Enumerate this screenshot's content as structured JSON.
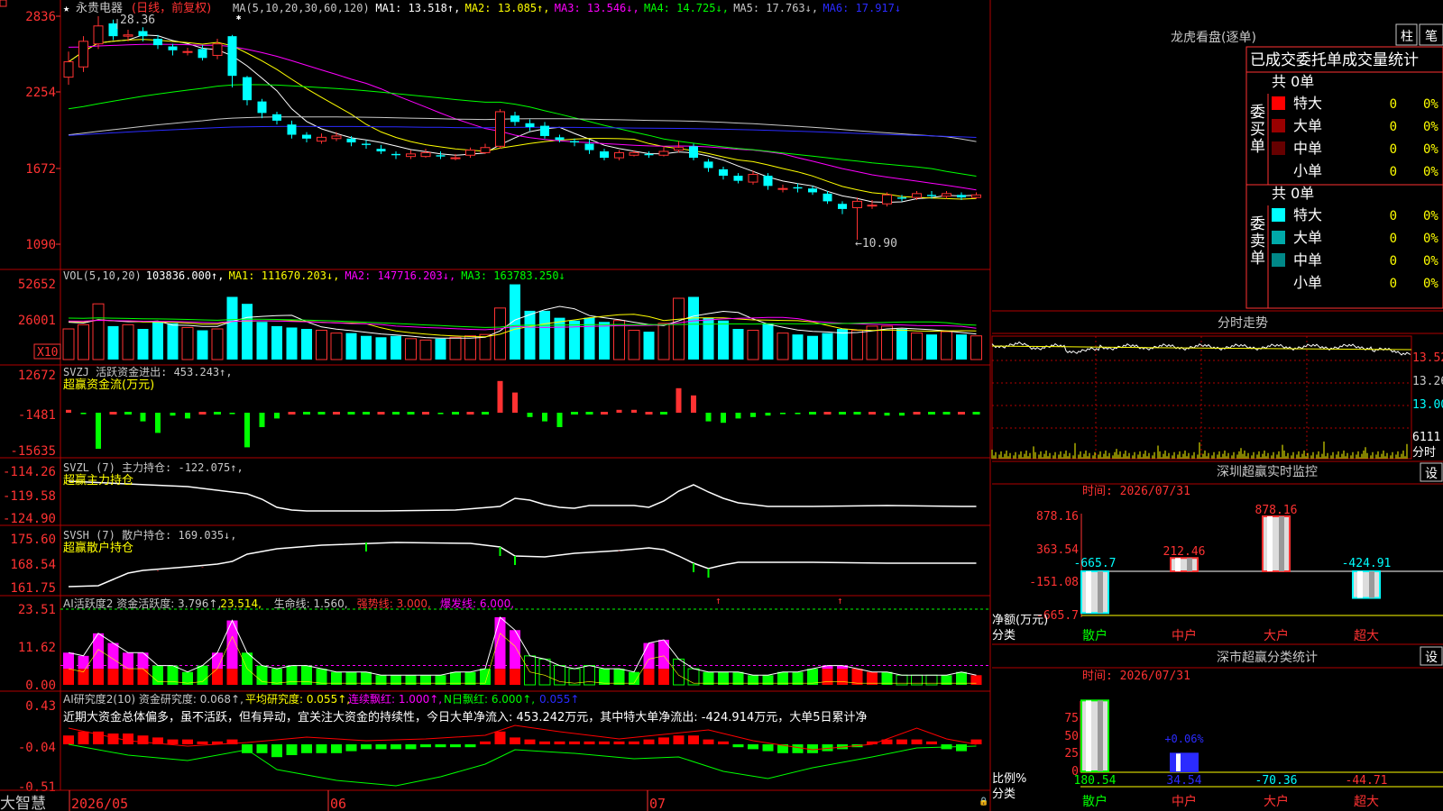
{
  "stock": {
    "name": "永贵电器",
    "mode": "(日线，前复权)",
    "hi_mark": "28.36",
    "lo_mark": "←10.90",
    "star": "★"
  },
  "main_yaxis": [
    "2836",
    "2254",
    "1672",
    "1090"
  ],
  "ma_header": [
    {
      "t": "MA(5,10,20,30,60,120)",
      "c": "#c8c8c8"
    },
    {
      "t": "MA1: 13.518↑,",
      "c": "#ffffff"
    },
    {
      "t": "MA2: 13.085↑,",
      "c": "#ffff00"
    },
    {
      "t": "MA3: 13.546↓,",
      "c": "#ff00ff"
    },
    {
      "t": "MA4: 14.725↓,",
      "c": "#00ff00"
    },
    {
      "t": "MA5: 17.763↓,",
      "c": "#c8c8c8"
    },
    {
      "t": "MA6: 17.917↓",
      "c": "#2b2bff"
    }
  ],
  "vol_header": [
    {
      "t": "VOL(5,10,20)",
      "c": "#c8c8c8"
    },
    {
      "t": "103836.000↑,",
      "c": "#ffffff"
    },
    {
      "t": "MA1: 111670.203↓,",
      "c": "#ffff00"
    },
    {
      "t": "MA2: 147716.203↓,",
      "c": "#ff00ff"
    },
    {
      "t": "MA3: 163783.250↓",
      "c": "#00ff00"
    }
  ],
  "vol_yaxis": [
    "52652",
    "26001"
  ],
  "vol_unit": "X10",
  "svzj": {
    "header": "SVZJ  活跃资金进出: 453.243↑,",
    "sub": "超赢资金流(万元)",
    "yaxis": [
      "12672",
      "-1481",
      "-15635"
    ]
  },
  "svzl": {
    "header": "SVZL (7) 主力持仓: -122.075↑,",
    "sub": "超赢主力持仓",
    "yaxis": [
      "-114.26",
      "-119.58",
      "-124.90"
    ]
  },
  "svsh": {
    "header": "SVSH (7) 散户持仓: 169.035↓,",
    "sub": "超赢散户持仓",
    "yaxis": [
      "175.60",
      "168.54",
      "161.75"
    ]
  },
  "ai1": {
    "header": [
      {
        "t": "AI活跃度2 资金活跃度: 3.796↑,",
        "c": "#c8c8c8"
      },
      {
        "t": "23.514,",
        "c": "#ffff00"
      },
      {
        "t": "生命线: 1.560,",
        "c": "#c8c8c8"
      },
      {
        "t": "强势线: 3.000,",
        "c": "#ff3333"
      },
      {
        "t": "爆发线: 6.000,",
        "c": "#ff00ff"
      }
    ],
    "yaxis": [
      "23.51",
      "11.62",
      "0.00"
    ]
  },
  "ai2": {
    "header": [
      {
        "t": "AI研究度2(10) 资金研究度: 0.068↑,",
        "c": "#c8c8c8"
      },
      {
        "t": "平均研究度: 0.055↑,",
        "c": "#ffff00"
      },
      {
        "t": "连续飘红: 1.000↑,",
        "c": "#ff00ff"
      },
      {
        "t": "N日飘红: 6.000↑,",
        "c": "#00ff00"
      },
      {
        "t": "0.055↑",
        "c": "#2b2bff"
      }
    ],
    "comment": "近期大资金总体偏多，虽不活跃，但有异动，宜关注大资金的持续性，今日大单净流入: 453.242万元，其中特大单净流出: -424.914万元，大单5日累计净",
    "yaxis": [
      "0.43",
      "-0.04",
      "-0.51"
    ]
  },
  "xaxis": {
    "brand": "大智慧",
    "labels": [
      "2026/05",
      "06",
      "07"
    ]
  },
  "candles": [
    {
      "o": 23.6,
      "c": 24.8,
      "h": 25.6,
      "l": 23.0
    },
    {
      "o": 24.4,
      "c": 26.4,
      "h": 26.8,
      "l": 24.0
    },
    {
      "o": 26.2,
      "c": 27.6,
      "h": 28.36,
      "l": 25.8
    },
    {
      "o": 27.8,
      "c": 26.8,
      "h": 28.1,
      "l": 26.5
    },
    {
      "o": 26.8,
      "c": 26.9,
      "h": 27.3,
      "l": 26.4
    },
    {
      "o": 27.2,
      "c": 26.8,
      "h": 27.5,
      "l": 26.4
    },
    {
      "o": 26.6,
      "c": 26.1,
      "h": 26.9,
      "l": 25.8
    },
    {
      "o": 26.0,
      "c": 25.7,
      "h": 26.2,
      "l": 25.3
    },
    {
      "o": 25.6,
      "c": 25.6,
      "h": 25.9,
      "l": 25.3
    },
    {
      "o": 25.8,
      "c": 25.1,
      "h": 26.1,
      "l": 24.9
    },
    {
      "o": 25.3,
      "c": 26.2,
      "h": 26.6,
      "l": 25.0
    },
    {
      "o": 26.8,
      "c": 23.7,
      "h": 26.9,
      "l": 22.8
    },
    {
      "o": 23.6,
      "c": 21.8,
      "h": 23.7,
      "l": 21.4
    },
    {
      "o": 21.7,
      "c": 20.8,
      "h": 21.9,
      "l": 20.4
    },
    {
      "o": 20.7,
      "c": 20.2,
      "h": 20.9,
      "l": 19.9
    },
    {
      "o": 19.9,
      "c": 19.1,
      "h": 20.2,
      "l": 18.8
    },
    {
      "o": 19.1,
      "c": 18.8,
      "h": 19.3,
      "l": 18.5
    },
    {
      "o": 18.6,
      "c": 18.9,
      "h": 19.2,
      "l": 18.4
    },
    {
      "o": 18.8,
      "c": 19.0,
      "h": 19.3,
      "l": 18.6
    },
    {
      "o": 18.8,
      "c": 18.5,
      "h": 19.0,
      "l": 18.2
    },
    {
      "o": 18.4,
      "c": 18.3,
      "h": 18.7,
      "l": 18.0
    },
    {
      "o": 18.0,
      "c": 17.8,
      "h": 18.3,
      "l": 17.6
    },
    {
      "o": 17.6,
      "c": 17.5,
      "h": 17.8,
      "l": 17.2
    },
    {
      "o": 17.4,
      "c": 17.6,
      "h": 17.9,
      "l": 17.2
    },
    {
      "o": 17.4,
      "c": 17.7,
      "h": 18.0,
      "l": 17.3
    },
    {
      "o": 17.5,
      "c": 17.4,
      "h": 17.8,
      "l": 17.2
    },
    {
      "o": 17.3,
      "c": 17.3,
      "h": 17.6,
      "l": 17.1
    },
    {
      "o": 17.5,
      "c": 17.9,
      "h": 18.1,
      "l": 17.3
    },
    {
      "o": 17.7,
      "c": 18.1,
      "h": 18.4,
      "l": 17.6
    },
    {
      "o": 18.2,
      "c": 20.9,
      "h": 21.1,
      "l": 18.0
    },
    {
      "o": 20.6,
      "c": 20.1,
      "h": 20.9,
      "l": 19.8
    },
    {
      "o": 20.0,
      "c": 19.7,
      "h": 20.3,
      "l": 19.4
    },
    {
      "o": 19.8,
      "c": 19.0,
      "h": 20.1,
      "l": 18.8
    },
    {
      "o": 18.9,
      "c": 18.7,
      "h": 19.1,
      "l": 18.5
    },
    {
      "o": 18.6,
      "c": 18.5,
      "h": 18.8,
      "l": 18.2
    },
    {
      "o": 18.4,
      "c": 17.9,
      "h": 18.7,
      "l": 17.6
    },
    {
      "o": 17.8,
      "c": 17.3,
      "h": 18.0,
      "l": 17.1
    },
    {
      "o": 17.3,
      "c": 17.7,
      "h": 17.9,
      "l": 17.1
    },
    {
      "o": 17.5,
      "c": 17.7,
      "h": 17.9,
      "l": 17.4
    },
    {
      "o": 17.6,
      "c": 17.5,
      "h": 17.8,
      "l": 17.3
    },
    {
      "o": 17.5,
      "c": 17.8,
      "h": 18.2,
      "l": 17.4
    },
    {
      "o": 17.9,
      "c": 18.1,
      "h": 18.6,
      "l": 17.7
    },
    {
      "o": 18.2,
      "c": 17.3,
      "h": 18.4,
      "l": 17.1
    },
    {
      "o": 17.0,
      "c": 16.5,
      "h": 17.2,
      "l": 16.2
    },
    {
      "o": 16.4,
      "c": 15.9,
      "h": 16.6,
      "l": 15.6
    },
    {
      "o": 15.9,
      "c": 15.5,
      "h": 16.1,
      "l": 15.3
    },
    {
      "o": 15.4,
      "c": 16.0,
      "h": 16.3,
      "l": 15.2
    },
    {
      "o": 15.9,
      "c": 15.1,
      "h": 16.1,
      "l": 14.8
    },
    {
      "o": 14.9,
      "c": 14.9,
      "h": 15.2,
      "l": 14.6
    },
    {
      "o": 15.0,
      "c": 14.9,
      "h": 15.3,
      "l": 14.6
    },
    {
      "o": 14.9,
      "c": 14.6,
      "h": 15.1,
      "l": 14.4
    },
    {
      "o": 14.5,
      "c": 13.9,
      "h": 14.7,
      "l": 13.7
    },
    {
      "o": 13.7,
      "c": 13.3,
      "h": 13.9,
      "l": 12.9
    },
    {
      "o": 13.4,
      "c": 13.9,
      "h": 14.2,
      "l": 10.9
    },
    {
      "o": 13.6,
      "c": 13.6,
      "h": 14.0,
      "l": 13.3
    },
    {
      "o": 13.7,
      "c": 14.4,
      "h": 14.6,
      "l": 13.5
    },
    {
      "o": 14.2,
      "c": 14.1,
      "h": 14.4,
      "l": 13.9
    },
    {
      "o": 14.2,
      "c": 14.5,
      "h": 14.7,
      "l": 14.0
    },
    {
      "o": 14.4,
      "c": 14.3,
      "h": 14.7,
      "l": 14.1
    },
    {
      "o": 14.3,
      "c": 14.5,
      "h": 14.7,
      "l": 14.1
    },
    {
      "o": 14.4,
      "c": 14.2,
      "h": 14.6,
      "l": 14.0
    },
    {
      "o": 14.2,
      "c": 14.4,
      "h": 14.6,
      "l": 14.1
    }
  ],
  "right": {
    "tabs": [
      "柱",
      "笔"
    ],
    "dragon": {
      "title": "龙虎看盘(逐单)",
      "header": "已成交委托单成交量统计",
      "buy": {
        "side": "委买单",
        "total": "共 0单",
        "rows": [
          {
            "label": "特大",
            "val": "0",
            "pct": "0%",
            "color": "#ff0000"
          },
          {
            "label": "大单",
            "val": "0",
            "pct": "0%",
            "color": "#990000"
          },
          {
            "label": "中单",
            "val": "0",
            "pct": "0%",
            "color": "#660000"
          },
          {
            "label": "小单",
            "val": "0",
            "pct": "0%",
            "color": ""
          }
        ]
      },
      "sell": {
        "side": "委卖单",
        "total": "共 0单",
        "rows": [
          {
            "label": "特大",
            "val": "0",
            "pct": "0%",
            "color": "#00ffff"
          },
          {
            "label": "大单",
            "val": "0",
            "pct": "0%",
            "color": "#00aaaa"
          },
          {
            "label": "中单",
            "val": "0",
            "pct": "0%",
            "color": "#008888"
          },
          {
            "label": "小单",
            "val": "0",
            "pct": "0%",
            "color": ""
          }
        ]
      }
    },
    "intraday": {
      "title": "分时走势",
      "yaxis": [
        "13.52",
        "13.26",
        "13.00"
      ],
      "vol_label": "6111",
      "vol_unit": "分时"
    },
    "monitor": {
      "title": "深圳超赢实时监控",
      "setting": "设",
      "time": "时间: 2026/07/31",
      "yaxis": [
        "878.16",
        "363.54",
        "-151.08",
        "-665.7"
      ],
      "ylabel": "净额(万元)",
      "xlabel": "分类",
      "cats": [
        "散户",
        "中户",
        "大户",
        "超大"
      ],
      "values": [
        -665.7,
        212.46,
        878.16,
        -424.91
      ],
      "labels": [
        "-665.7",
        "212.46",
        "878.16",
        "-424.91"
      ]
    },
    "classify": {
      "title": "深市超赢分类统计",
      "setting": "设",
      "time": "时间: 2026/07/31",
      "yaxis": [
        "75",
        "50",
        "25",
        "0"
      ],
      "ylabel": "比例%",
      "xlabel": "分类",
      "cats": [
        "散户",
        "中户",
        "大户",
        "超大"
      ],
      "bars": [
        75,
        25,
        0,
        0
      ],
      "bar_label": "+0.06%",
      "values": [
        "180.54",
        "34.54",
        "-70.36",
        "-44.71"
      ],
      "value_colors": [
        "#00ff00",
        "#2b2bff",
        "#00ffff",
        "#ff3333"
      ]
    }
  }
}
